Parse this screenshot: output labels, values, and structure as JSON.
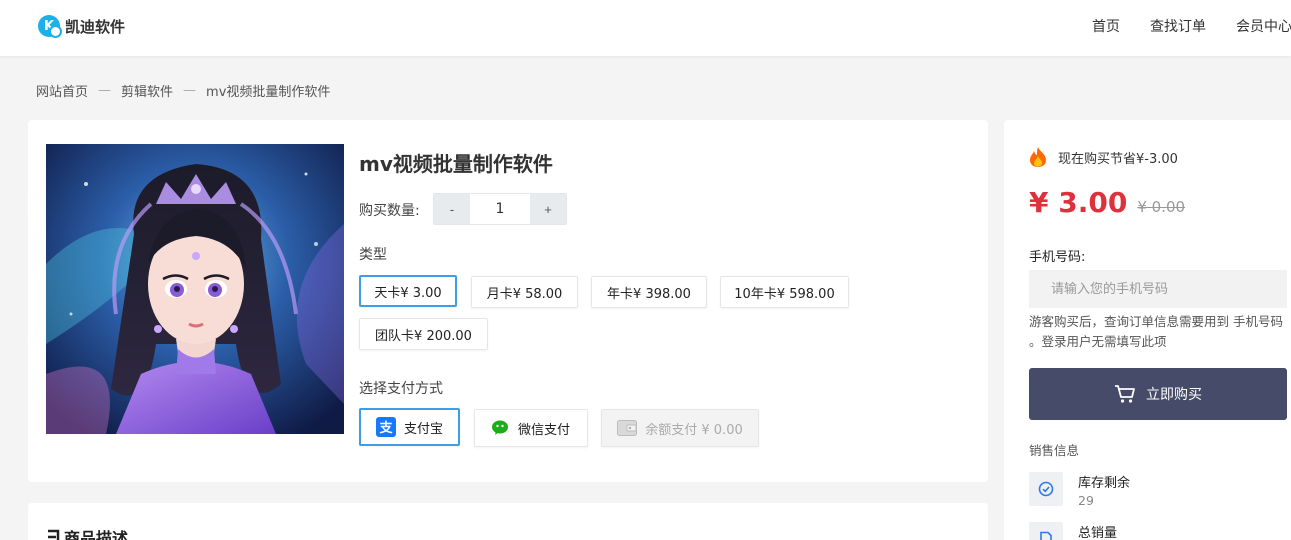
{
  "header": {
    "logo_text": "凯迪软件",
    "logo_mark": "K",
    "nav": [
      "首页",
      "查找订单",
      "会员中心"
    ]
  },
  "breadcrumb": [
    "网站首页",
    "剪辑软件",
    "mv视频批量制作软件"
  ],
  "breadcrumb_sep": "—",
  "product": {
    "title": "mv视频批量制作软件",
    "quantity_label": "购买数量:",
    "quantity_minus": "-",
    "quantity_value": "1",
    "quantity_plus": "+",
    "type_label": "类型",
    "types": [
      {
        "label": "天卡¥ 3.00",
        "selected": true
      },
      {
        "label": "月卡¥ 58.00",
        "selected": false
      },
      {
        "label": "年卡¥ 398.00",
        "selected": false
      },
      {
        "label": "10年卡¥ 598.00",
        "selected": false
      },
      {
        "label": "团队卡¥ 200.00",
        "selected": false
      }
    ],
    "payment_label": "选择支付方式",
    "payments": [
      {
        "label": "支付宝",
        "icon": "alipay-icon",
        "selected": true
      },
      {
        "label": "微信支付",
        "icon": "wechat-icon",
        "selected": false
      },
      {
        "label": "余额支付 ¥ 0.00",
        "icon": "wallet-icon",
        "disabled": true
      }
    ]
  },
  "description": {
    "title": "商品描述"
  },
  "side": {
    "save_text": "现在购买节省¥-3.00",
    "price_now": "¥ 3.00",
    "price_old": "¥ 0.00",
    "phone_label": "手机号码:",
    "phone_placeholder": "请输入您的手机号码",
    "hint": "游客购买后，查询订单信息需要用到 手机号码 。登录用户无需填写此项",
    "buy_label": "立即购买",
    "sales_label": "销售信息",
    "stats": [
      {
        "title": "库存剩余",
        "value": "29"
      },
      {
        "title": "总销量",
        "value": ""
      }
    ]
  },
  "colors": {
    "accent": "#3d9ee6",
    "price": "#e0303c",
    "buy_button": "#454b68",
    "logo": "#1ab1e8"
  }
}
